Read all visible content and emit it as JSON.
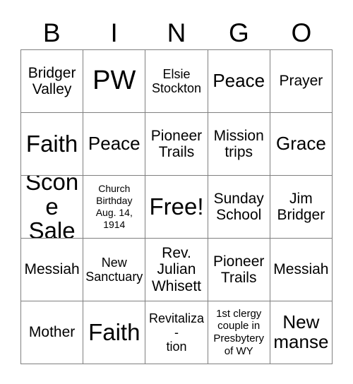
{
  "card": {
    "title": "BINGO",
    "background_color": "#ffffff",
    "text_color": "#000000",
    "border_color": "#808080",
    "columns": 5,
    "rows": 5
  },
  "header": {
    "letters": [
      "B",
      "I",
      "N",
      "G",
      "O"
    ]
  },
  "grid": {
    "free_space_label": "Free!",
    "free_space_position": {
      "row": 3,
      "column": 3
    },
    "rows": [
      [
        {
          "text": "Bridger Valley",
          "size": "md",
          "free": false
        },
        {
          "text": "PW",
          "size": "xxl",
          "free": false
        },
        {
          "text": "Elsie Stockton",
          "size": "sm",
          "free": false
        },
        {
          "text": "Peace",
          "size": "lg",
          "free": false
        },
        {
          "text": "Prayer",
          "size": "md",
          "free": false
        }
      ],
      [
        {
          "text": "Faith",
          "size": "xl",
          "free": false
        },
        {
          "text": "Peace",
          "size": "lg",
          "free": false
        },
        {
          "text": "Pioneer Trails",
          "size": "md",
          "free": false
        },
        {
          "text": "Mission trips",
          "size": "md",
          "free": false
        },
        {
          "text": "Grace",
          "size": "lg",
          "free": false
        }
      ],
      [
        {
          "text": "Scone Sale",
          "size": "xl",
          "free": false
        },
        {
          "text": "Church Birthday Aug. 14, 1914",
          "size": "xxs",
          "free": false
        },
        {
          "text": "Free!",
          "size": "xl",
          "free": true
        },
        {
          "text": "Sunday School",
          "size": "md",
          "free": false
        },
        {
          "text": "Jim Bridger",
          "size": "md",
          "free": false
        }
      ],
      [
        {
          "text": "Messiah",
          "size": "md",
          "free": false
        },
        {
          "text": "New Sanctuary",
          "size": "sm",
          "free": false
        },
        {
          "text": "Rev. Julian Whisett",
          "size": "md",
          "free": false
        },
        {
          "text": "Pioneer Trails",
          "size": "md",
          "free": false
        },
        {
          "text": "Messiah",
          "size": "md",
          "free": false
        }
      ],
      [
        {
          "text": "Mother",
          "size": "md",
          "free": false
        },
        {
          "text": "Faith",
          "size": "xl",
          "free": false
        },
        {
          "text": "Revitaliza-\ntion",
          "size": "sm",
          "free": false
        },
        {
          "text": "1st clergy couple in Presbytery of WY",
          "size": "xs",
          "free": false
        },
        {
          "text": "New manse",
          "size": "lg",
          "free": false
        }
      ]
    ]
  }
}
